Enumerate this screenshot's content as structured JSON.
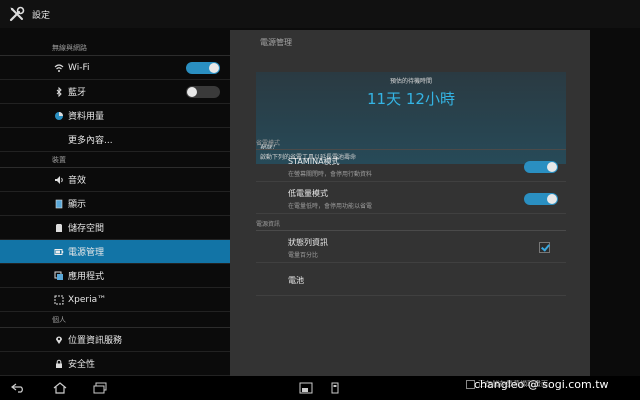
{
  "app": {
    "title": "設定"
  },
  "sidebar": {
    "sections": [
      {
        "header": "無線與網路"
      },
      {
        "header": "裝置"
      },
      {
        "header": "個人"
      }
    ],
    "wireless": [
      {
        "label": "Wi-Fi",
        "icon": "wifi-icon",
        "toggle": "on"
      },
      {
        "label": "藍牙",
        "icon": "bluetooth-icon",
        "toggle": "off"
      },
      {
        "label": "資料用量",
        "icon": "data-usage-icon"
      },
      {
        "label": "更多內容..."
      }
    ],
    "device": [
      {
        "label": "音效",
        "icon": "sound-icon"
      },
      {
        "label": "顯示",
        "icon": "display-icon"
      },
      {
        "label": "儲存空間",
        "icon": "storage-icon"
      },
      {
        "label": "電源管理",
        "icon": "power-icon",
        "selected": true
      },
      {
        "label": "應用程式",
        "icon": "apps-icon"
      },
      {
        "label": "Xperia™",
        "icon": "xperia-icon"
      }
    ],
    "personal": [
      {
        "label": "位置資訊服務",
        "icon": "location-icon"
      },
      {
        "label": "安全性",
        "icon": "lock-icon"
      }
    ]
  },
  "panel": {
    "title": "電源管理",
    "banner": {
      "est_label": "預估的待機時間",
      "est_time": "11天 12小時",
      "tip_title": "秘訣！",
      "tip_text": "啟動下列的省電工具以延長電池壽命"
    },
    "power_saving_header": "省電模式",
    "stamina": {
      "title": "STAMINA模式",
      "summary": "在螢幕關閉時，會停用行動資料"
    },
    "low_battery": {
      "title": "低電量模式",
      "summary": "在電量低時，會停用功能以省電"
    },
    "power_info_header": "電源資訊",
    "status_bar": {
      "title": "狀態列資訊",
      "summary": "電量百分比"
    },
    "battery": {
      "title": "電池"
    }
  },
  "navbar": {
    "notification": "正在儲存螢幕擷取畫面"
  },
  "watermark": "changleo @ sogi.com.tw",
  "colors": {
    "accent": "#1274a6",
    "toggle_on": "#2a8fc1",
    "time_blue": "#34b4e4"
  }
}
